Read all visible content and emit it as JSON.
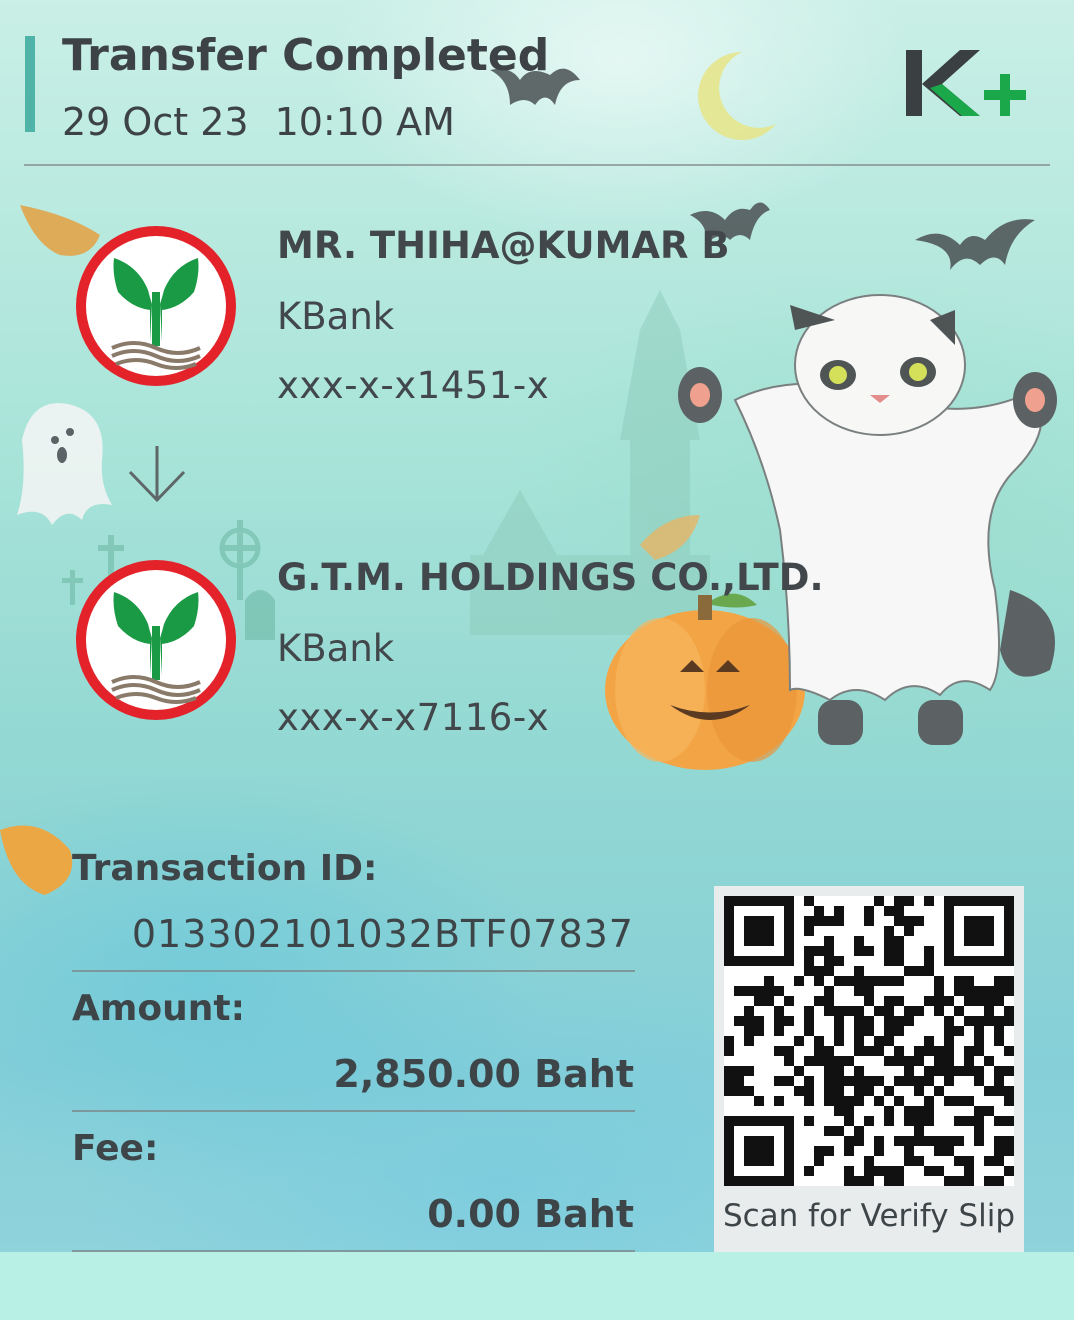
{
  "header": {
    "title": "Transfer Completed",
    "date": "29 Oct 23",
    "time": "10:10 AM",
    "logo_text": "K+"
  },
  "sender": {
    "name": "MR. THIHA@KUMAR B",
    "bank": "KBank",
    "account": "xxx-x-x1451-x"
  },
  "receiver": {
    "name": "G.T.M. HOLDINGS CO.,LTD.",
    "bank": "KBank",
    "account": "xxx-x-x7116-x"
  },
  "details": {
    "transaction_id_label": "Transaction ID:",
    "transaction_id": "013302101032BTF07837",
    "amount_label": "Amount:",
    "amount": "2,850.00 Baht",
    "fee_label": "Fee:",
    "fee": "0.00 Baht"
  },
  "qr": {
    "caption": "Scan for Verify Slip"
  },
  "icons": {
    "arrow": "arrow-down-icon",
    "bank": "kbank-logo-icon",
    "app": "kplus-logo-icon"
  },
  "colors": {
    "kbank_red": "#e3222a",
    "kbank_green": "#1a9a45",
    "kplus_green": "#1aa84a",
    "accent": "#4fb3a7"
  }
}
